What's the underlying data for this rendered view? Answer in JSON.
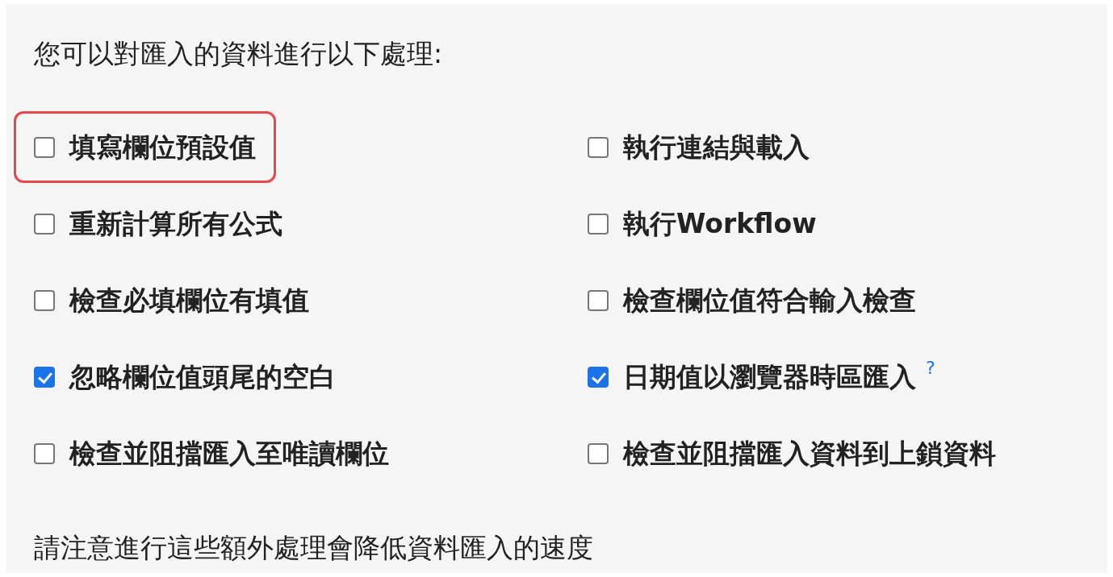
{
  "intro": "您可以對匯入的資料進行以下處理:",
  "options": [
    {
      "label": "填寫欄位預設值",
      "checked": false,
      "highlighted": true
    },
    {
      "label": "執行連結與載入",
      "checked": false,
      "highlighted": false
    },
    {
      "label": "重新計算所有公式",
      "checked": false,
      "highlighted": false
    },
    {
      "label": "執行Workflow",
      "checked": false,
      "highlighted": false
    },
    {
      "label": "檢查必填欄位有填值",
      "checked": false,
      "highlighted": false
    },
    {
      "label": "檢查欄位值符合輸入檢查",
      "checked": false,
      "highlighted": false
    },
    {
      "label": "忽略欄位值頭尾的空白",
      "checked": true,
      "highlighted": false
    },
    {
      "label": "日期值以瀏覽器時區匯入",
      "checked": true,
      "highlighted": false,
      "help": "?"
    },
    {
      "label": "檢查並阻擋匯入至唯讀欄位",
      "checked": false,
      "highlighted": false
    },
    {
      "label": "檢查並阻擋匯入資料到上鎖資料",
      "checked": false,
      "highlighted": false
    }
  ],
  "note": "請注意進行這些額外處理會降低資料匯入的速度"
}
